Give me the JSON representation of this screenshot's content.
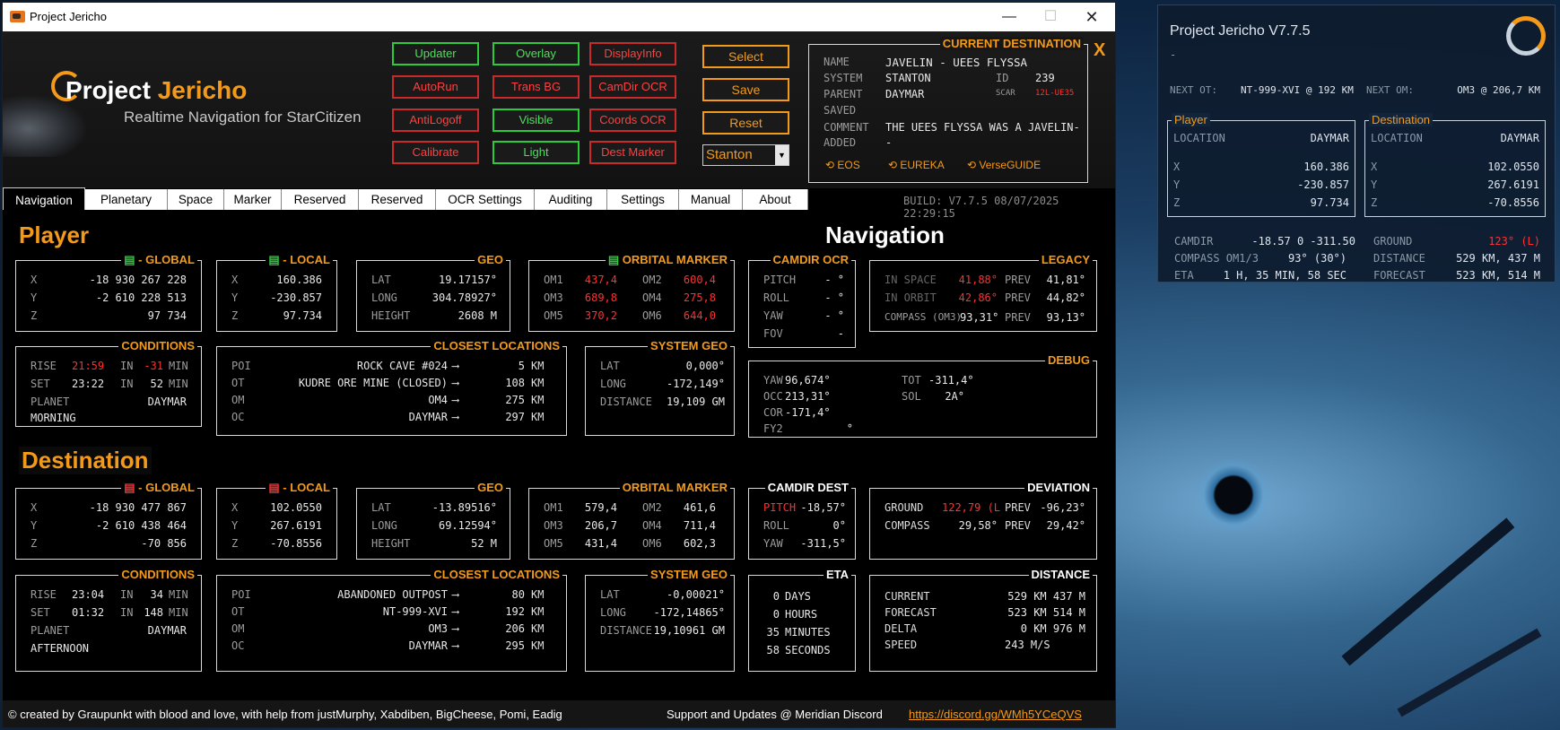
{
  "window": {
    "title": "Project Jericho"
  },
  "logo": {
    "title": "Project ",
    "title_accent": "Jericho",
    "subtitle": "Realtime Navigation for StarCitizen"
  },
  "toolbar": {
    "col1": [
      {
        "label": "Updater",
        "state": "on"
      },
      {
        "label": "AutoRun",
        "state": "off"
      },
      {
        "label": "AntiLogoff",
        "state": "off"
      },
      {
        "label": "Calibrate",
        "state": "off"
      }
    ],
    "col2": [
      {
        "label": "Overlay",
        "state": "on"
      },
      {
        "label": "Trans BG",
        "state": "off"
      },
      {
        "label": "Visible",
        "state": "on"
      },
      {
        "label": "Light",
        "state": "on"
      }
    ],
    "col3": [
      {
        "label": "DisplayInfo",
        "state": "off"
      },
      {
        "label": "CamDir OCR",
        "state": "off"
      },
      {
        "label": "Coords OCR",
        "state": "off"
      },
      {
        "label": "Dest Marker",
        "state": "off"
      }
    ],
    "select_label": "Select",
    "save_label": "Save",
    "reset_label": "Reset",
    "system": "Stanton"
  },
  "current_destination": {
    "caption": "CURRENT DESTINATION",
    "close": "X",
    "name_label": "NAME",
    "name": "JAVELIN - UEES FLYSSA",
    "system_label": "SYSTEM",
    "system": "STANTON",
    "id_label": "ID",
    "id": "239",
    "scar_label": "SCAR",
    "scar": "12L-UE35",
    "parent_label": "PARENT",
    "parent": "DAYMAR",
    "saved_label": "SAVED",
    "saved": "",
    "comment_label": "COMMENT",
    "comment": "THE UEES FLYSSA WAS A JAVELIN-",
    "added_label": "ADDED",
    "added": "-",
    "links": [
      "EOS",
      "EUREKA",
      "VerseGUIDE"
    ]
  },
  "tabs": [
    "Navigation",
    "Planetary",
    "Space",
    "Marker",
    "Reserved",
    "Reserved",
    "OCR Settings",
    "Auditing",
    "Settings",
    "Manual",
    "About"
  ],
  "build": "BUILD: V7.7.5 08/07/2025 22:29:15",
  "player": {
    "title": "Player",
    "global": {
      "caption": "- GLOBAL",
      "x": "-18 930 267 228",
      "y": "-2 610 228 513",
      "z": "97 734"
    },
    "local": {
      "caption": "- LOCAL",
      "x": "160.386",
      "y": "-230.857",
      "z": "97.734"
    },
    "geo": {
      "caption": "GEO",
      "lat_label": "LAT",
      "lat": "19.17157°",
      "long_label": "LONG",
      "long": "304.78927°",
      "height_label": "HEIGHT",
      "height": "2608 M"
    },
    "orbital": {
      "caption": "ORBITAL MARKER",
      "om1": "437,4",
      "om2": "600,4",
      "om3": "689,8",
      "om4": "275,8",
      "om5": "370,2",
      "om6": "644,0"
    },
    "conditions": {
      "caption": "CONDITIONS",
      "rise_label": "RISE",
      "rise": "21:59",
      "rise_in_label": "IN",
      "rise_in": "-31",
      "rise_unit": "MIN",
      "set_label": "SET",
      "set": "23:22",
      "set_in_label": "IN",
      "set_in": "52",
      "set_unit": "MIN",
      "planet_label": "PLANET",
      "planet": "DAYMAR",
      "phase": "MORNING"
    },
    "closest": {
      "caption": "CLOSEST LOCATIONS",
      "rows": [
        {
          "type": "POI",
          "name": "ROCK CAVE #024",
          "arrow": "⟶",
          "dist": "5",
          "unit": "KM"
        },
        {
          "type": "OT",
          "name": "KUDRE ORE MINE (CLOSED)",
          "arrow": "⟶",
          "dist": "108",
          "unit": "KM"
        },
        {
          "type": "OM",
          "name": "OM4",
          "arrow": "⟶",
          "dist": "275",
          "unit": "KM"
        },
        {
          "type": "OC",
          "name": "DAYMAR",
          "arrow": "⟶",
          "dist": "297",
          "unit": "KM"
        }
      ]
    },
    "sysgeo": {
      "caption": "SYSTEM GEO",
      "lat_label": "LAT",
      "lat": "0,000°",
      "long_label": "LONG",
      "long": "-172,149°",
      "dist_label": "DISTANCE",
      "dist": "19,109 GM"
    }
  },
  "navigation": {
    "title": "Navigation"
  },
  "camdir_ocr": {
    "caption": "CAMDIR OCR",
    "pitch_label": "PITCH",
    "pitch": "- °",
    "roll_label": "ROLL",
    "roll": "- °",
    "yaw_label": "YAW",
    "yaw": "- °",
    "fov_label": "FOV",
    "fov": "-"
  },
  "legacy": {
    "caption": "LEGACY",
    "inspace_label": "IN SPACE",
    "inspace": "41,88°",
    "prev1_label": "PREV",
    "prev1": "41,81°",
    "inorbit_label": "IN ORBIT",
    "inorbit": "42,86°",
    "prev2_label": "PREV",
    "prev2": "44,82°",
    "compass_label": "COMPASS (OM3)",
    "compass": "93,31°",
    "prev3_label": "PREV",
    "prev3": "93,13°"
  },
  "debug": {
    "caption": "DEBUG",
    "yaw_label": "YAW",
    "yaw": "96,674°",
    "tot_label": "TOT",
    "tot": "-311,4°",
    "occ_label": "OCC",
    "occ": "213,31°",
    "sol_label": "SOL",
    "sol": "2A°",
    "cor_label": "COR",
    "cor": "-171,4°",
    "fy2_label": "FY2",
    "fy2": "°"
  },
  "destination": {
    "title": "Destination",
    "global": {
      "caption": "- GLOBAL",
      "x": "-18 930 477 867",
      "y": "-2 610 438 464",
      "z": "-70 856"
    },
    "local": {
      "caption": "- LOCAL",
      "x": "102.0550",
      "y": "267.6191",
      "z": "-70.8556"
    },
    "geo": {
      "caption": "GEO",
      "lat_label": "LAT",
      "lat": "-13.89516°",
      "long_label": "LONG",
      "long": "69.12594°",
      "height_label": "HEIGHT",
      "height": "52 M"
    },
    "orbital": {
      "caption": "ORBITAL MARKER",
      "om1": "579,4",
      "om2": "461,6",
      "om3": "206,7",
      "om4": "711,4",
      "om5": "431,4",
      "om6": "602,3"
    },
    "conditions": {
      "caption": "CONDITIONS",
      "rise_label": "RISE",
      "rise": "23:04",
      "rise_in_label": "IN",
      "rise_in": "34",
      "rise_unit": "MIN",
      "set_label": "SET",
      "set": "01:32",
      "set_in_label": "IN",
      "set_in": "148",
      "set_unit": "MIN",
      "planet_label": "PLANET",
      "planet": "DAYMAR",
      "phase": "AFTERNOON"
    },
    "closest": {
      "caption": "CLOSEST LOCATIONS",
      "rows": [
        {
          "type": "POI",
          "name": "ABANDONED OUTPOST",
          "arrow": "⟶",
          "dist": "80",
          "unit": "KM"
        },
        {
          "type": "OT",
          "name": "NT-999-XVI",
          "arrow": "⟶",
          "dist": "192",
          "unit": "KM"
        },
        {
          "type": "OM",
          "name": "OM3",
          "arrow": "⟶",
          "dist": "206",
          "unit": "KM"
        },
        {
          "type": "OC",
          "name": "DAYMAR",
          "arrow": "⟶",
          "dist": "295",
          "unit": "KM"
        }
      ]
    },
    "sysgeo": {
      "caption": "SYSTEM GEO",
      "lat_label": "LAT",
      "lat": "-0,00021°",
      "long_label": "LONG",
      "long": "-172,14865°",
      "dist_label": "DISTANCE",
      "dist": "19,10961 GM"
    }
  },
  "camdir_dest": {
    "caption": "CAMDIR DEST",
    "pitch_label": "PITCH",
    "pitch": "-18,57°",
    "roll_label": "ROLL",
    "roll": "0°",
    "yaw_label": "YAW",
    "yaw": "-311,5°"
  },
  "deviation": {
    "caption": "DEVIATION",
    "ground_label": "GROUND",
    "ground": "122,79 (L",
    "prev1_label": "PREV",
    "prev1": "-96,23°",
    "compass_label": "COMPASS",
    "compass": "29,58°",
    "prev2_label": "PREV",
    "prev2": "29,42°"
  },
  "eta": {
    "caption": "ETA",
    "days": "0",
    "days_label": "DAYS",
    "hours": "0",
    "hours_label": "HOURS",
    "minutes": "35",
    "minutes_label": "MINUTES",
    "seconds": "58",
    "seconds_label": "SECONDS"
  },
  "distance": {
    "caption": "DISTANCE",
    "current_label": "CURRENT",
    "current": "529 KM 437 M",
    "forecast_label": "FORECAST",
    "forecast": "523 KM 514 M",
    "delta_label": "DELTA",
    "delta": "0 KM 976 M",
    "speed_label": "SPEED",
    "speed": "243 M/S"
  },
  "footer": {
    "credits": "© created by Graupunkt with blood and love, with help from justMurphy, Xabdiben, BigCheese, Pomi, Eadig",
    "support": "Support and Updates @ Meridian Discord",
    "link": "https://discord.gg/WMh5YCeQVS"
  },
  "overlay": {
    "title": "Project Jericho V7.7.5",
    "dash": "-",
    "next_ot_label": "NEXT OT:",
    "next_ot": "NT-999-XVI @ 192 KM",
    "next_om_label": "NEXT OM:",
    "next_om": "OM3 @ 206,7 KM",
    "player": {
      "caption": "Player",
      "location_label": "LOCATION",
      "location": "DAYMAR",
      "x": "160.386",
      "y": "-230.857",
      "z": "97.734"
    },
    "destination": {
      "caption": "Destination",
      "location_label": "LOCATION",
      "location": "DAYMAR",
      "x": "102.0550",
      "y": "267.6191",
      "z": "-70.8556"
    },
    "camdir_label": "CAMDIR",
    "camdir": "-18.57  0  -311.50",
    "compass_label": "COMPASS OM1/3",
    "compass": "93° (30°)",
    "eta_label": "ETA",
    "eta": "1 H, 35 MIN, 58 SEC",
    "ground_label": "GROUND",
    "ground": "123° (L)",
    "distance_label": "DISTANCE",
    "distance": "529 KM, 437 M",
    "forecast_label": "FORECAST",
    "forecast": "523 KM, 514 M"
  },
  "colors": {
    "accent": "#f39a1a",
    "on": "#2ccb3a",
    "off": "#c92b2b",
    "alert": "#ff3030"
  }
}
